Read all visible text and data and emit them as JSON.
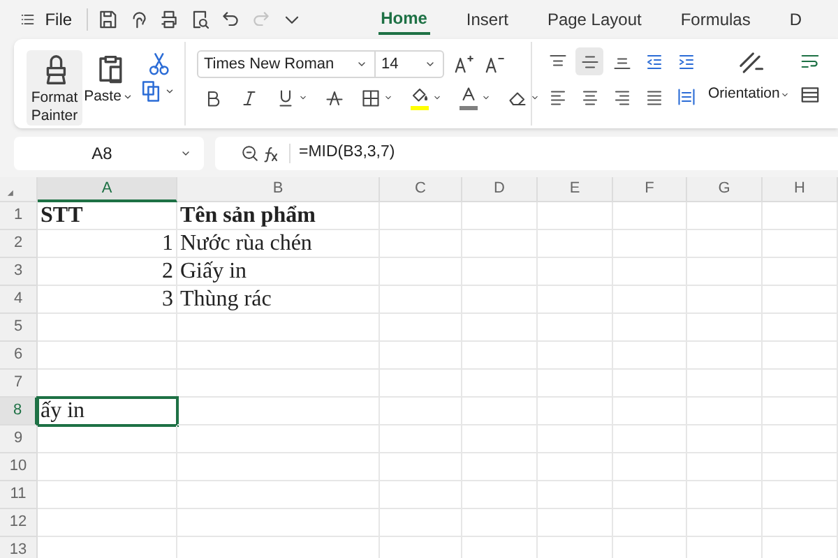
{
  "title_bar": {
    "file_label": "File",
    "quick_access": [
      {
        "kind": "save",
        "disabled": false
      },
      {
        "kind": "touch",
        "disabled": false
      },
      {
        "kind": "print",
        "disabled": false
      },
      {
        "kind": "preview",
        "disabled": false
      },
      {
        "kind": "undo",
        "disabled": false
      },
      {
        "kind": "redo",
        "disabled": true
      },
      {
        "kind": "more",
        "disabled": false
      }
    ],
    "tabs": [
      {
        "label": "Home",
        "selected": true
      },
      {
        "label": "Insert",
        "selected": false
      },
      {
        "label": "Page Layout",
        "selected": false
      },
      {
        "label": "Formulas",
        "selected": false
      },
      {
        "label": "D",
        "selected": false
      }
    ]
  },
  "ribbon": {
    "clipboard": {
      "format_painter": "Format Painter",
      "paste": "Paste"
    },
    "font": {
      "name": "Times New Roman",
      "size": "14",
      "buttons": [
        {
          "kind": "bold"
        },
        {
          "kind": "italic"
        },
        {
          "kind": "underline"
        },
        {
          "kind": "strike"
        },
        {
          "kind": "borders"
        },
        {
          "kind": "fill",
          "color": "#ffff00"
        },
        {
          "kind": "fontcolor",
          "color": "#808080"
        },
        {
          "kind": "eraser"
        }
      ]
    },
    "alignment": {
      "vertical": [
        {
          "kind": "top",
          "selected": false
        },
        {
          "kind": "middle",
          "selected": true
        },
        {
          "kind": "bottom",
          "selected": false
        },
        {
          "kind": "outdent",
          "selected": false
        },
        {
          "kind": "indent",
          "selected": false
        }
      ],
      "horizontal": [
        {
          "kind": "left",
          "selected": false
        },
        {
          "kind": "center",
          "selected": false
        },
        {
          "kind": "right",
          "selected": false
        },
        {
          "kind": "justify",
          "selected": false
        },
        {
          "kind": "distributed",
          "selected": false
        }
      ],
      "orientation": "Orientation"
    }
  },
  "formula_bar": {
    "name_box": "A8",
    "formula": "=MID(B3,3,7)"
  },
  "sheet": {
    "columns": [
      {
        "label": "A",
        "selected": true
      },
      {
        "label": "B",
        "selected": false
      },
      {
        "label": "C",
        "selected": false
      },
      {
        "label": "D",
        "selected": false
      },
      {
        "label": "E",
        "selected": false
      },
      {
        "label": "F",
        "selected": false
      },
      {
        "label": "G",
        "selected": false
      },
      {
        "label": "H",
        "selected": false
      }
    ],
    "rows": [
      {
        "number": "1",
        "selected": false,
        "cells": [
          {
            "text": "STT",
            "kind": "text",
            "bold": true,
            "selected": false
          },
          {
            "text": "Tên sản phẩm",
            "kind": "text",
            "bold": true,
            "selected": false
          }
        ]
      },
      {
        "number": "2",
        "selected": false,
        "cells": [
          {
            "text": "1",
            "kind": "number",
            "bold": false,
            "selected": false
          },
          {
            "text": "Nước rùa chén",
            "kind": "text",
            "bold": false,
            "selected": false
          }
        ]
      },
      {
        "number": "3",
        "selected": false,
        "cells": [
          {
            "text": "2",
            "kind": "number",
            "bold": false,
            "selected": false
          },
          {
            "text": "Giấy in",
            "kind": "text",
            "bold": false,
            "selected": false
          }
        ]
      },
      {
        "number": "4",
        "selected": false,
        "cells": [
          {
            "text": "3",
            "kind": "number",
            "bold": false,
            "selected": false
          },
          {
            "text": "Thùng rác",
            "kind": "text",
            "bold": false,
            "selected": false
          }
        ]
      },
      {
        "number": "5",
        "selected": false
      },
      {
        "number": "6",
        "selected": false
      },
      {
        "number": "7",
        "selected": false
      },
      {
        "number": "8",
        "selected": true,
        "cells": [
          {
            "text": "ấy in",
            "kind": "text",
            "bold": false,
            "selected": true
          }
        ]
      },
      {
        "number": "9",
        "selected": false
      },
      {
        "number": "10",
        "selected": false
      },
      {
        "number": "11",
        "selected": false
      },
      {
        "number": "12",
        "selected": false
      },
      {
        "number": "13",
        "selected": false
      }
    ]
  }
}
